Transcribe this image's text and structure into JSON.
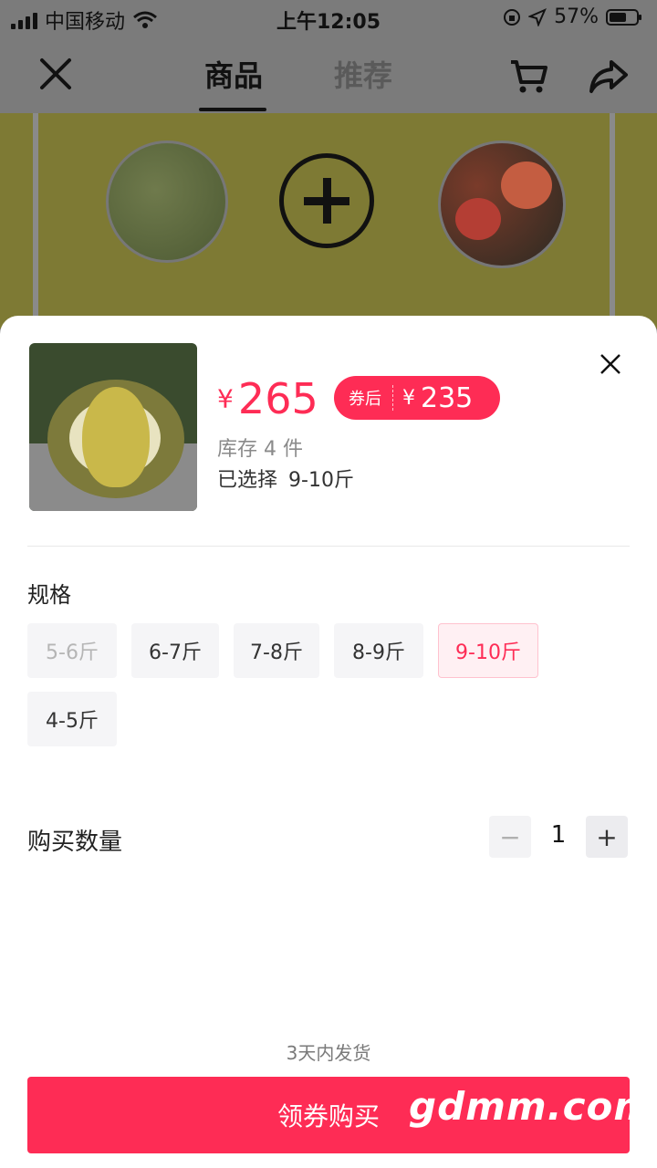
{
  "status_bar": {
    "carrier": "中国移动",
    "time": "上午12:05",
    "battery_pct": "57%"
  },
  "nav": {
    "tab_goods": "商品",
    "tab_recommend": "推荐"
  },
  "product": {
    "price_currency": "¥",
    "price": "265",
    "coupon_tag": "券后",
    "coupon_currency": "¥",
    "coupon_price": "235",
    "stock": "库存 4 件",
    "selected_label": "已选择",
    "selected_value": "9-10斤"
  },
  "spec": {
    "title": "规格",
    "options": [
      {
        "label": "5-6斤",
        "state": "disabled"
      },
      {
        "label": "6-7斤",
        "state": "normal"
      },
      {
        "label": "7-8斤",
        "state": "normal"
      },
      {
        "label": "8-9斤",
        "state": "normal"
      },
      {
        "label": "9-10斤",
        "state": "selected"
      },
      {
        "label": "4-5斤",
        "state": "normal"
      }
    ]
  },
  "quantity": {
    "title": "购买数量",
    "minus": "−",
    "value": "1",
    "plus": "+"
  },
  "footer": {
    "shipping": "3天内发货",
    "buy_label": "领券购买",
    "watermark": "gdmm.com"
  },
  "colors": {
    "accent": "#fe2c55"
  }
}
